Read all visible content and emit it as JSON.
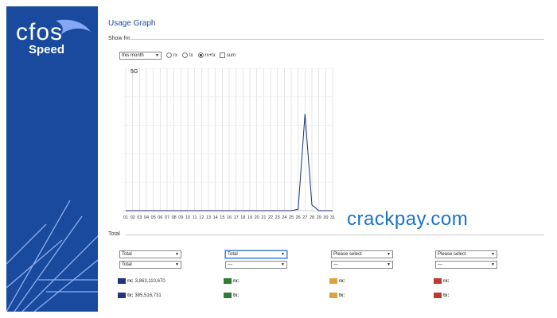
{
  "brand": {
    "line1": "cfos",
    "line2": "Speed"
  },
  "page": {
    "title": "Usage Graph"
  },
  "show_for": {
    "label": "Show for",
    "period": "this month",
    "options": [
      {
        "label": "rx",
        "type": "radio",
        "checked": false
      },
      {
        "label": "tx",
        "type": "radio",
        "checked": false
      },
      {
        "label": "rx+tx",
        "type": "radio",
        "checked": true
      },
      {
        "label": "sum",
        "type": "checkbox",
        "checked": false
      }
    ]
  },
  "chart_data": {
    "type": "line",
    "title": "",
    "ylabel_top": "5G",
    "x": [
      "01",
      "02",
      "03",
      "04",
      "05",
      "06",
      "07",
      "08",
      "09",
      "10",
      "11",
      "12",
      "13",
      "14",
      "15",
      "16",
      "17",
      "18",
      "19",
      "20",
      "21",
      "22",
      "23",
      "24",
      "25",
      "26",
      "27",
      "28",
      "29",
      "30",
      "31"
    ],
    "series": [
      {
        "values": [
          0,
          0,
          0,
          0,
          0,
          0,
          0,
          0,
          0,
          0,
          0,
          0,
          0,
          0,
          0,
          0,
          0,
          0,
          0,
          0,
          0,
          0,
          0,
          0,
          0,
          0.05,
          3.4,
          0.2,
          0,
          0,
          0
        ],
        "color": "#1a2e7a"
      }
    ],
    "ylim": [
      0,
      5
    ],
    "grid": true
  },
  "total": {
    "label": "Total",
    "columns": [
      {
        "select1": "Total",
        "select2": "Total",
        "color": "#24337a",
        "rx_label": "rx:",
        "rx_value": "3,863,110,670",
        "tx_label": "tx:",
        "tx_value": "385,516,731",
        "highlighted": false
      },
      {
        "select1": "Total",
        "select2": "---",
        "color": "#2e7d32",
        "rx_label": "rx:",
        "rx_value": "",
        "tx_label": "tx:",
        "tx_value": "",
        "highlighted": true
      },
      {
        "select1": "Please select",
        "select2": "---",
        "color": "#e0a040",
        "rx_label": "rx:",
        "rx_value": "",
        "tx_label": "tx:",
        "tx_value": "",
        "highlighted": false
      },
      {
        "select1": "Please select",
        "select2": "---",
        "color": "#c0392b",
        "rx_label": "rx:",
        "rx_value": "",
        "tx_label": "tx:",
        "tx_value": "",
        "highlighted": false
      }
    ]
  },
  "watermark": "crackpay.com"
}
